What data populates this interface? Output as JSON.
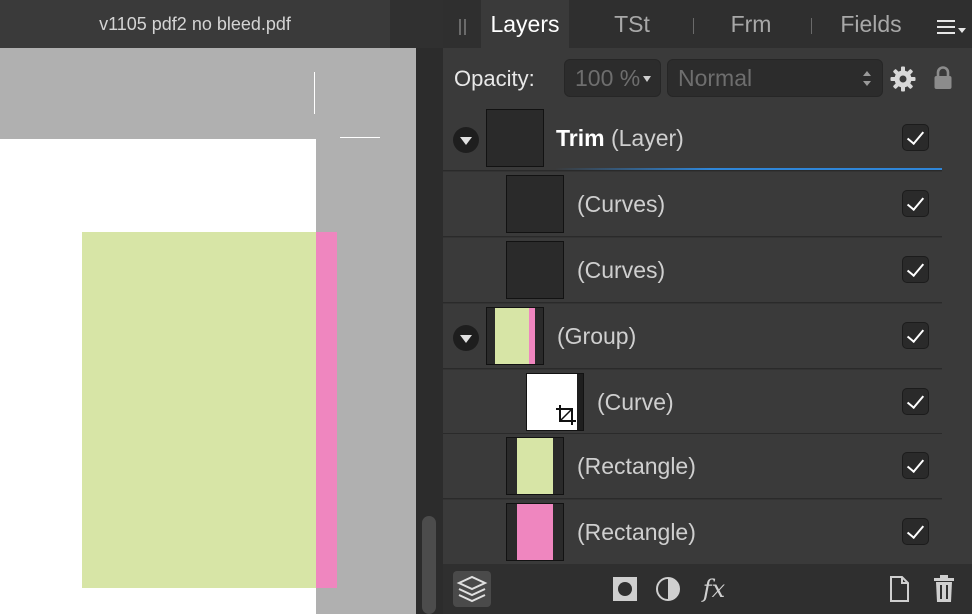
{
  "document": {
    "title": "v1105 pdf2 no bleed.pdf",
    "colors": {
      "green_rect": "#d7e5a6",
      "pink_rect": "#ef86bf",
      "page": "#ffffff",
      "pasteboard": "#b0b0b0"
    }
  },
  "panel": {
    "tabs": [
      {
        "label": "Layers",
        "active": true
      },
      {
        "label": "TSt",
        "active": false
      },
      {
        "label": "Frm",
        "active": false
      },
      {
        "label": "Fields",
        "active": false
      }
    ],
    "menu_icon": "hamburger-menu-icon",
    "opacity": {
      "label": "Opacity:",
      "value": "100 %"
    },
    "blend_mode": {
      "value": "Normal"
    },
    "icons": [
      "gear-icon",
      "lock-icon"
    ]
  },
  "layers": [
    {
      "name": "Trim",
      "type": "(Layer)",
      "bold": true,
      "expandable": true,
      "indent": 0,
      "visible": true,
      "selected": true
    },
    {
      "name": "",
      "type": "(Curves)",
      "bold": false,
      "expandable": false,
      "indent": 1,
      "visible": true
    },
    {
      "name": "",
      "type": "(Curves)",
      "bold": false,
      "expandable": false,
      "indent": 1,
      "visible": true
    },
    {
      "name": "",
      "type": "(Group)",
      "bold": false,
      "expandable": true,
      "indent": 0,
      "visible": true
    },
    {
      "name": "",
      "type": "(Curve)",
      "bold": false,
      "expandable": false,
      "indent": 2,
      "visible": true
    },
    {
      "name": "",
      "type": "(Rectangle)",
      "bold": false,
      "expandable": false,
      "indent": 1,
      "visible": true
    },
    {
      "name": "",
      "type": "(Rectangle)",
      "bold": false,
      "expandable": false,
      "indent": 1,
      "visible": true
    }
  ],
  "footer_icons": [
    "layers-stack-icon",
    "mask-icon",
    "adjustment-icon",
    "fx-icon",
    "new-document-icon",
    "trash-icon"
  ],
  "footer": {
    "fx_label": "fx"
  }
}
